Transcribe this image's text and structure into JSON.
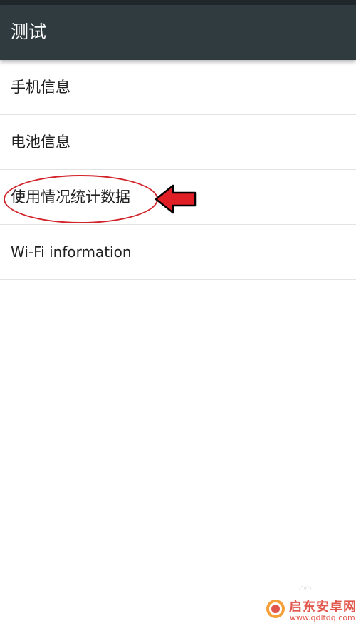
{
  "toolbar": {
    "title": "测试"
  },
  "list": {
    "items": [
      {
        "label": "手机信息"
      },
      {
        "label": "电池信息"
      },
      {
        "label": "使用情况统计数据"
      },
      {
        "label": "Wi-Fi information"
      }
    ]
  },
  "annotation": {
    "color": "#d2232a"
  },
  "watermark": {
    "title": "启东安卓网",
    "url": "www.qdltdq.com"
  },
  "colors": {
    "toolbar": "#2f3b3f",
    "status_bar": "#1f272b",
    "text": "#212121",
    "divider": "#e3e3e3"
  }
}
